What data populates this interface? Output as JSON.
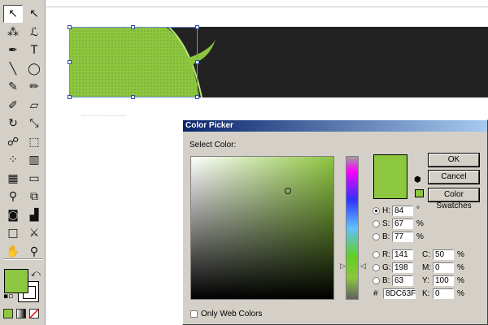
{
  "colors": {
    "fill": "#8DC63F",
    "stroke": "#ffffff",
    "banner_dark": "#222222",
    "dialog_bg": "#d4d0c8"
  },
  "toolbox": {
    "tools": [
      {
        "name": "selection-tool-icon",
        "glyph": "↖"
      },
      {
        "name": "direct-selection-tool-icon",
        "glyph": "↖"
      },
      {
        "name": "magic-wand-tool-icon",
        "glyph": "⁂"
      },
      {
        "name": "lasso-tool-icon",
        "glyph": "ℒ"
      },
      {
        "name": "pen-tool-icon",
        "glyph": "✒"
      },
      {
        "name": "type-tool-icon",
        "glyph": "T"
      },
      {
        "name": "line-tool-icon",
        "glyph": "╲"
      },
      {
        "name": "ellipse-tool-icon",
        "glyph": "◯"
      },
      {
        "name": "paintbrush-tool-icon",
        "glyph": "✎"
      },
      {
        "name": "pencil-tool-icon",
        "glyph": "✏"
      },
      {
        "name": "blob-brush-tool-icon",
        "glyph": "✐"
      },
      {
        "name": "eraser-tool-icon",
        "glyph": "▱"
      },
      {
        "name": "rotate-tool-icon",
        "glyph": "↻"
      },
      {
        "name": "scale-tool-icon",
        "glyph": "⤡"
      },
      {
        "name": "warp-tool-icon",
        "glyph": "☍"
      },
      {
        "name": "free-transform-tool-icon",
        "glyph": "⬚"
      },
      {
        "name": "symbol-sprayer-tool-icon",
        "glyph": "⁘"
      },
      {
        "name": "column-graph-tool-icon",
        "glyph": "▥"
      },
      {
        "name": "mesh-tool-icon",
        "glyph": "▦"
      },
      {
        "name": "gradient-tool-icon",
        "glyph": "▭"
      },
      {
        "name": "eyedropper-tool-icon",
        "glyph": "⚲"
      },
      {
        "name": "blend-tool-icon",
        "glyph": "⧉"
      },
      {
        "name": "live-paint-bucket-tool-icon",
        "glyph": "◙"
      },
      {
        "name": "chart-tool-icon",
        "glyph": "▟"
      },
      {
        "name": "artboard-tool-icon",
        "glyph": "□"
      },
      {
        "name": "slice-tool-icon",
        "glyph": "⚔"
      },
      {
        "name": "hand-tool-icon",
        "glyph": "✋"
      },
      {
        "name": "zoom-tool-icon",
        "glyph": "⚲"
      }
    ]
  },
  "dialog": {
    "title": "Color Picker",
    "select_color_label": "Select Color:",
    "ok_label": "OK",
    "cancel_label": "Cancel",
    "swatches_label": "Color Swatches",
    "only_web_label": "Only Web Colors",
    "h_label": "H:",
    "h_value": "84",
    "h_unit": "°",
    "s_label": "S:",
    "s_value": "67",
    "s_unit": "%",
    "b_label": "B:",
    "b_value": "77",
    "b_unit": "%",
    "r_label": "R:",
    "r_value": "141",
    "g_label": "G:",
    "g_value": "198",
    "bl_label": "B:",
    "bl_value": "63",
    "hex_label": "#",
    "hex_value": "8DC63F",
    "c_label": "C:",
    "c_value": "50",
    "c_unit": "%",
    "m_label": "M:",
    "m_value": "0",
    "m_unit": "%",
    "y_label": "Y:",
    "y_value": "100",
    "y_unit": "%",
    "k_label": "K:",
    "k_value": "0",
    "k_unit": "%"
  }
}
